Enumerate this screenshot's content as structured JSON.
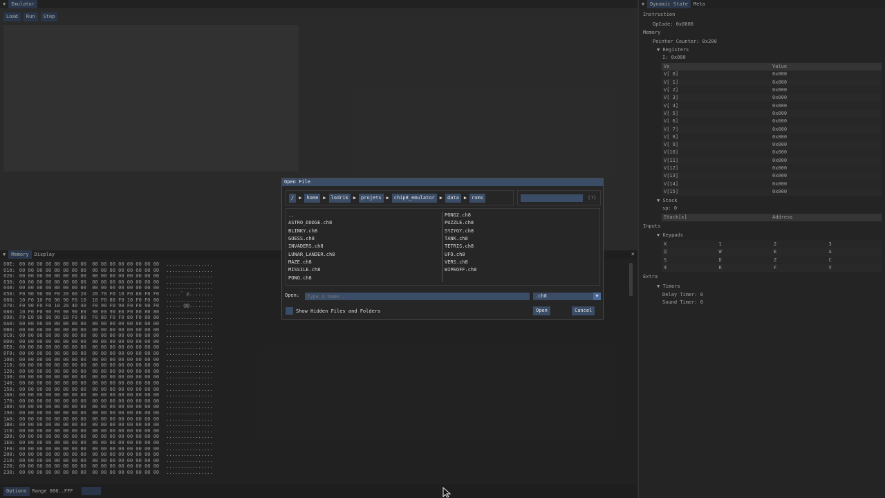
{
  "emulator": {
    "tab": "Emulator",
    "buttons": [
      "Load",
      "Run",
      "Step"
    ]
  },
  "memory": {
    "tabs": [
      "Memory",
      "Display"
    ],
    "rows": [
      [
        "00E:",
        "00 00 00 00 00 00 00 00  00 00 00 00 00 00 00 00",
        "................"
      ],
      [
        "010:",
        "00 00 00 00 00 00 00 00  00 00 00 00 00 00 00 00",
        "................"
      ],
      [
        "020:",
        "00 00 00 00 00 00 00 00  00 00 00 00 00 00 00 00",
        "................"
      ],
      [
        "030:",
        "00 00 00 00 00 00 00 00  00 00 00 00 00 00 00 00",
        "................"
      ],
      [
        "040:",
        "00 00 00 00 00 00 00 00  00 00 00 00 00 00 00 00",
        "................"
      ],
      [
        "050:",
        "F0 90 90 90 F0 20 60 20  20 70 F0 10 F0 80 F0 F0",
        ".....` p........"
      ],
      [
        "060:",
        "10 F0 10 F0 90 90 F0 10  10 F0 80 F0 10 F0 F0 80",
        "................"
      ],
      [
        "070:",
        "F0 90 F0 F0 10 20 40 40  F0 90 F0 90 F0 F0 90 F0",
        "..... @@........"
      ],
      [
        "080:",
        "10 F0 F0 90 F0 90 90 E0  90 E0 90 E0 F0 80 80 80",
        "................"
      ],
      [
        "090:",
        "F0 E0 90 90 90 E0 F0 80  F0 80 F0 F0 80 F0 80 80",
        "................"
      ],
      [
        "0A0:",
        "00 00 00 00 00 00 00 00  00 00 00 00 00 00 00 00",
        "................"
      ],
      [
        "0B0:",
        "00 00 00 00 00 00 00 00  00 00 00 00 00 00 00 00",
        "................"
      ],
      [
        "0C0:",
        "00 00 00 00 00 00 00 00  00 00 00 00 00 00 00 00",
        "................"
      ],
      [
        "0D0:",
        "00 00 00 00 00 00 00 00  00 00 00 00 00 00 00 00",
        "................"
      ],
      [
        "0E0:",
        "00 00 00 00 00 00 00 00  00 00 00 00 00 00 00 00",
        "................"
      ],
      [
        "0F0:",
        "00 00 00 00 00 00 00 00  00 00 00 00 00 00 00 00",
        "................"
      ],
      [
        "100:",
        "00 00 00 00 00 00 00 00  00 00 00 00 00 00 00 00",
        "................"
      ],
      [
        "110:",
        "00 00 00 00 00 00 00 00  00 00 00 00 00 00 00 00",
        "................"
      ],
      [
        "120:",
        "00 00 00 00 00 00 00 00  00 00 00 00 00 00 00 00",
        "................"
      ],
      [
        "130:",
        "00 00 00 00 00 00 00 00  00 00 00 00 00 00 00 00",
        "................"
      ],
      [
        "140:",
        "00 00 00 00 00 00 00 00  00 00 00 00 00 00 00 00",
        "................"
      ],
      [
        "150:",
        "00 00 00 00 00 00 00 00  00 00 00 00 00 00 00 00",
        "................"
      ],
      [
        "160:",
        "00 00 00 00 00 00 00 00  00 00 00 00 00 00 00 00",
        "................"
      ],
      [
        "170:",
        "00 00 00 00 00 00 00 00  00 00 00 00 00 00 00 00",
        "................"
      ],
      [
        "180:",
        "00 00 00 00 00 00 00 00  00 00 00 00 00 00 00 00",
        "................"
      ],
      [
        "190:",
        "00 00 00 00 00 00 00 00  00 00 00 00 00 00 00 00",
        "................"
      ],
      [
        "1A0:",
        "00 00 00 00 00 00 00 00  00 00 00 00 00 00 00 00",
        "................"
      ],
      [
        "1B0:",
        "00 00 00 00 00 00 00 00  00 00 00 00 00 00 00 00",
        "................"
      ],
      [
        "1C0:",
        "00 00 00 00 00 00 00 00  00 00 00 00 00 00 00 00",
        "................"
      ],
      [
        "1D0:",
        "00 00 00 00 00 00 00 00  00 00 00 00 00 00 00 00",
        "................"
      ],
      [
        "1E0:",
        "00 00 00 00 00 00 00 00  00 00 00 00 00 00 00 00",
        "................"
      ],
      [
        "1F0:",
        "00 00 00 00 00 00 00 00  00 00 00 00 00 00 00 00",
        "................"
      ],
      [
        "200:",
        "00 00 00 00 00 00 00 00  00 00 00 00 00 00 00 00",
        "................"
      ],
      [
        "210:",
        "00 00 00 00 00 00 00 00  00 00 00 00 00 00 00 00",
        "................"
      ],
      [
        "220:",
        "00 00 00 00 00 00 00 00  00 00 00 00 00 00 00 00",
        "................"
      ],
      [
        "230:",
        "00 00 00 00 00 00 00 00  00 00 00 00 00 00 00 00",
        "................"
      ]
    ],
    "options_label": "Options",
    "range_label": "Range 000..FFF"
  },
  "dynamic": {
    "tabs": [
      "Dynamic State",
      "Meta"
    ],
    "instruction_header": "Instruction",
    "opcode": "OpCode: 0x0000",
    "memory_header": "Memory",
    "pointer_counter": "Pointer Counter: 0x200",
    "registers_label": "Registers",
    "i_register": "I: 0x000",
    "registers_cols": [
      "Vx",
      "Value"
    ],
    "registers": [
      [
        "V[ 0]",
        "0x000"
      ],
      [
        "V[ 1]",
        "0x000"
      ],
      [
        "V[ 2]",
        "0x000"
      ],
      [
        "V[ 3]",
        "0x000"
      ],
      [
        "V[ 4]",
        "0x000"
      ],
      [
        "V[ 5]",
        "0x000"
      ],
      [
        "V[ 6]",
        "0x000"
      ],
      [
        "V[ 7]",
        "0x000"
      ],
      [
        "V[ 8]",
        "0x000"
      ],
      [
        "V[ 9]",
        "0x000"
      ],
      [
        "V[10]",
        "0x000"
      ],
      [
        "V[11]",
        "0x000"
      ],
      [
        "V[12]",
        "0x000"
      ],
      [
        "V[13]",
        "0x000"
      ],
      [
        "V[14]",
        "0x000"
      ],
      [
        "V[15]",
        "0x000"
      ]
    ],
    "stack_label": "Stack",
    "sp": "sp: 0",
    "stack_cols": [
      "Stack[x]",
      "Address"
    ],
    "inputs_header": "Inputs",
    "keypads_label": "Keypads",
    "keypads": [
      [
        "X",
        "1",
        "2",
        "3"
      ],
      [
        "Q",
        "W",
        "E",
        "A"
      ],
      [
        "S",
        "D",
        "Z",
        "C"
      ],
      [
        "4",
        "R",
        "F",
        "V"
      ]
    ],
    "extra_header": "Extra",
    "timers_label": "Timers",
    "delay_timer": "Delay Timer: 0",
    "sound_timer": "Sound Timer: 0"
  },
  "dialog": {
    "title": "Open File",
    "path": [
      "/",
      "home",
      "lodrik",
      "projets",
      "chip8_emulator",
      "data",
      "roms"
    ],
    "search_hint": "(?)",
    "files_left": [
      "..",
      "ASTRO_DODGE.ch8",
      "BLINKY.ch8",
      "GUESS.ch8",
      "INVADERS.ch8",
      "LUNAR_LANDER.ch8",
      "MAZE.ch8",
      "MISSILE.ch8",
      "PONG.ch8"
    ],
    "files_right": [
      "PONG2.ch8",
      "PUZZLE.ch8",
      "SYZYGY.ch8",
      "TANK.ch8",
      "TETRIS.ch8",
      "UFO.ch8",
      "VERS.ch8",
      "WIPEOFF.ch8"
    ],
    "open_label": "Open:",
    "name_placeholder": "Type a name...",
    "filter": ".ch8",
    "show_hidden": "Show Hidden Files and Folders",
    "open_button": "Open",
    "cancel_button": "Cancel"
  }
}
